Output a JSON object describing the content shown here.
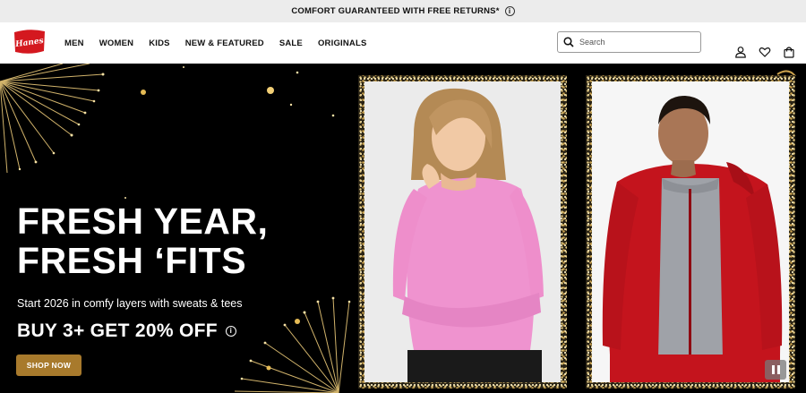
{
  "promo": {
    "text": "COMFORT GUARANTEED WITH FREE RETURNS*",
    "info": "i"
  },
  "header": {
    "logo_text": "Hanes",
    "nav": [
      "MEN",
      "WOMEN",
      "KIDS",
      "NEW & FEATURED",
      "SALE",
      "ORIGINALS"
    ],
    "search_placeholder": "Search",
    "icons": [
      "search-icon",
      "account-icon",
      "wishlist-heart-icon",
      "cart-bag-icon"
    ]
  },
  "hero": {
    "title_line1": "FRESH YEAR,",
    "title_line2": "FRESH ‘FITS",
    "subtitle": "Start 2026 in comfy layers with sweats & tees",
    "offer": "BUY 3+ GET 20% OFF",
    "offer_info": "i",
    "cta": "SHOP NOW"
  },
  "colors": {
    "brand_red": "#d4181f",
    "cta_gold": "#a87a2c",
    "promo_bg": "#ececec",
    "hero_bg": "#000000"
  }
}
